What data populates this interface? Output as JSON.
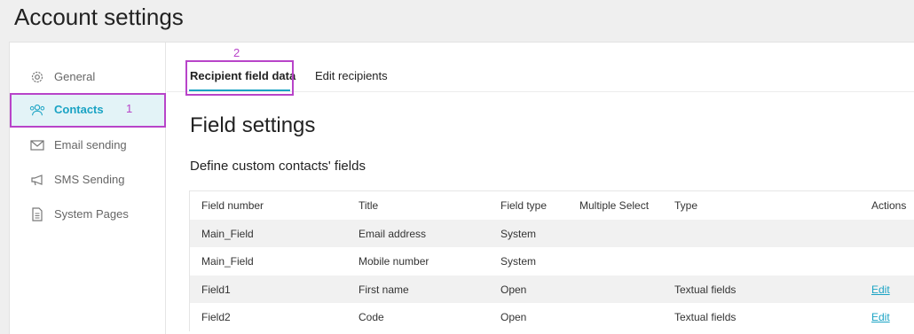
{
  "page": {
    "title": "Account settings"
  },
  "sidebar": {
    "items": [
      {
        "label": "General",
        "icon": "gear-icon"
      },
      {
        "label": "Contacts",
        "icon": "contacts-icon",
        "active": true
      },
      {
        "label": "Email sending",
        "icon": "envelope-icon"
      },
      {
        "label": "SMS Sending",
        "icon": "megaphone-icon"
      },
      {
        "label": "System Pages",
        "icon": "document-icon"
      }
    ]
  },
  "annotations": {
    "one": "1",
    "two": "2",
    "color": "#b844c9"
  },
  "tabs": [
    {
      "label": "Recipient field data",
      "active": true
    },
    {
      "label": "Edit recipients"
    }
  ],
  "main": {
    "section_title": "Field settings",
    "section_subtitle": "Define custom contacts' fields"
  },
  "table": {
    "headers": [
      "Field number",
      "Title",
      "Field type",
      "Multiple Select",
      "Type",
      "Actions"
    ],
    "rows": [
      [
        "Main_Field",
        "Email address",
        "System",
        "",
        "",
        ""
      ],
      [
        "Main_Field",
        "Mobile number",
        "System",
        "",
        "",
        ""
      ],
      [
        "Field1",
        "First name",
        "Open",
        "",
        "Textual fields",
        "Edit"
      ],
      [
        "Field2",
        "Code",
        "Open",
        "",
        "Textual fields",
        "Edit"
      ]
    ]
  },
  "colors": {
    "accent": "#1aa3c4",
    "active_bg": "#e3f3f7"
  }
}
